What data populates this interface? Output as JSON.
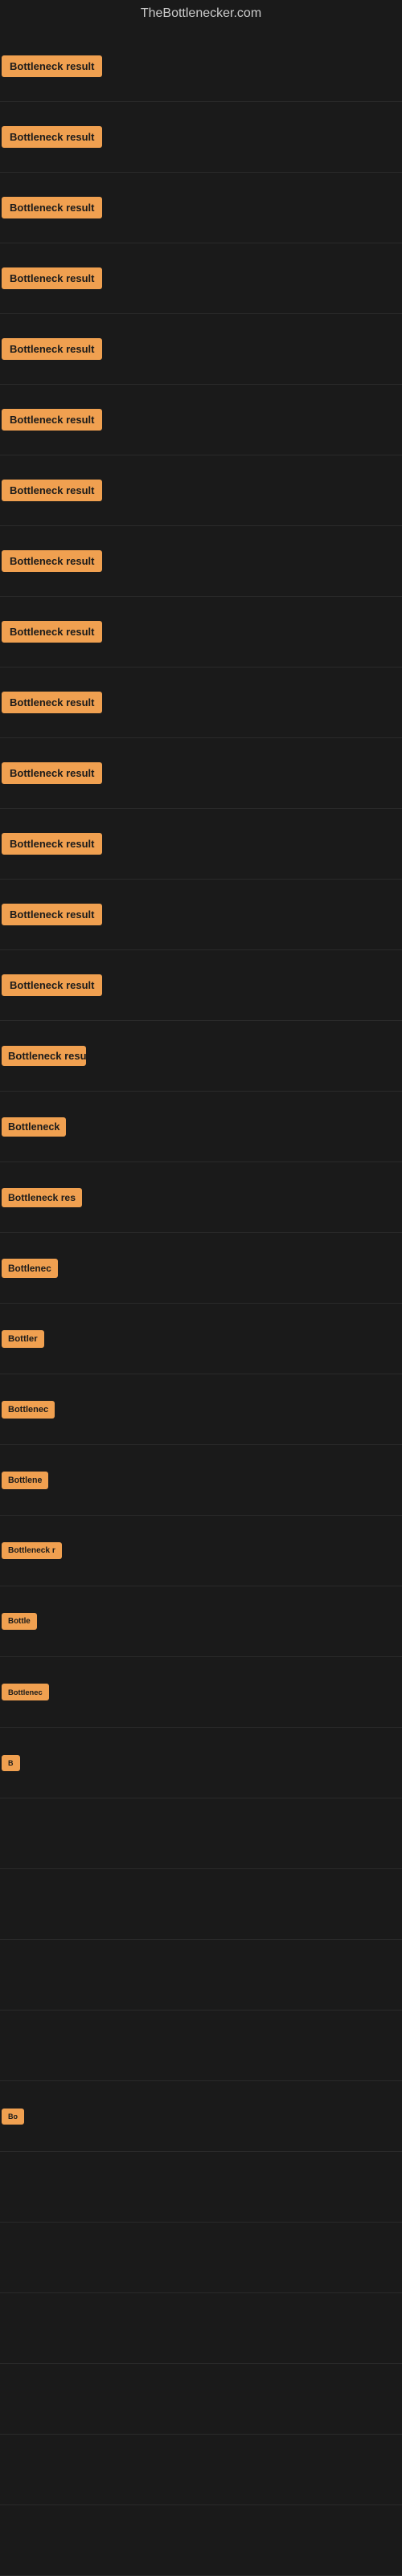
{
  "site": {
    "title": "TheBottlenecker.com"
  },
  "items": [
    {
      "id": 1,
      "label": "Bottleneck result",
      "badgeWidth": 120
    },
    {
      "id": 2,
      "label": "Bottleneck result",
      "badgeWidth": 120
    },
    {
      "id": 3,
      "label": "Bottleneck result",
      "badgeWidth": 120
    },
    {
      "id": 4,
      "label": "Bottleneck result",
      "badgeWidth": 120
    },
    {
      "id": 5,
      "label": "Bottleneck result",
      "badgeWidth": 120
    },
    {
      "id": 6,
      "label": "Bottleneck result",
      "badgeWidth": 120
    },
    {
      "id": 7,
      "label": "Bottleneck result",
      "badgeWidth": 120
    },
    {
      "id": 8,
      "label": "Bottleneck result",
      "badgeWidth": 115
    },
    {
      "id": 9,
      "label": "Bottleneck result",
      "badgeWidth": 115
    },
    {
      "id": 10,
      "label": "Bottleneck result",
      "badgeWidth": 115
    },
    {
      "id": 11,
      "label": "Bottleneck result",
      "badgeWidth": 115
    },
    {
      "id": 12,
      "label": "Bottleneck result",
      "badgeWidth": 110
    },
    {
      "id": 13,
      "label": "Bottleneck result",
      "badgeWidth": 110
    },
    {
      "id": 14,
      "label": "Bottleneck result",
      "badgeWidth": 110
    },
    {
      "id": 15,
      "label": "Bottleneck resu",
      "badgeWidth": 105
    },
    {
      "id": 16,
      "label": "Bottleneck",
      "badgeWidth": 85
    },
    {
      "id": 17,
      "label": "Bottleneck res",
      "badgeWidth": 100
    },
    {
      "id": 18,
      "label": "Bottlenec",
      "badgeWidth": 80
    },
    {
      "id": 19,
      "label": "Bottler",
      "badgeWidth": 65
    },
    {
      "id": 20,
      "label": "Bottlenec",
      "badgeWidth": 80
    },
    {
      "id": 21,
      "label": "Bottlene",
      "badgeWidth": 72
    },
    {
      "id": 22,
      "label": "Bottleneck r",
      "badgeWidth": 90
    },
    {
      "id": 23,
      "label": "Bottle",
      "badgeWidth": 60
    },
    {
      "id": 24,
      "label": "Bottlenec",
      "badgeWidth": 78
    },
    {
      "id": 25,
      "label": "B",
      "badgeWidth": 28
    },
    {
      "id": 26,
      "label": "",
      "badgeWidth": 8
    },
    {
      "id": 27,
      "label": "",
      "badgeWidth": 0
    },
    {
      "id": 28,
      "label": "",
      "badgeWidth": 0
    },
    {
      "id": 29,
      "label": "",
      "badgeWidth": 0
    },
    {
      "id": 30,
      "label": "Bo",
      "badgeWidth": 35
    },
    {
      "id": 31,
      "label": "",
      "badgeWidth": 0
    },
    {
      "id": 32,
      "label": "",
      "badgeWidth": 0
    },
    {
      "id": 33,
      "label": "",
      "badgeWidth": 0
    },
    {
      "id": 34,
      "label": "",
      "badgeWidth": 0
    },
    {
      "id": 35,
      "label": "",
      "badgeWidth": 0
    },
    {
      "id": 36,
      "label": "",
      "badgeWidth": 0
    }
  ],
  "colors": {
    "badge": "#f0a050",
    "background": "#1a1a1a",
    "title": "#cccccc"
  }
}
